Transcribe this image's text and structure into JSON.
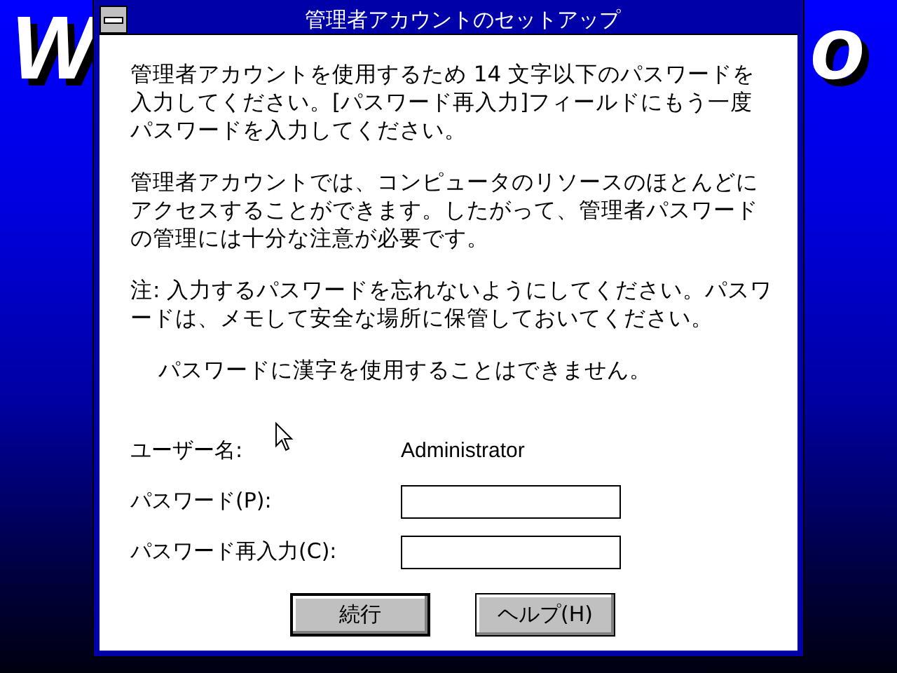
{
  "background": {
    "logo_fragments": [
      "W",
      "o"
    ]
  },
  "window": {
    "title": "管理者アカウントのセットアップ"
  },
  "paragraphs": [
    {
      "text": "管理者アカウントを使用するため 14 文字以下のパスワードを入力してください。[パスワード再入力]フィールドにもう一度パスワードを入力してください。",
      "indented": false
    },
    {
      "text": "管理者アカウントでは、コンピュータのリソースのほとんどにアクセスすることができます。したがって、管理者パスワードの管理には十分な注意が必要です。",
      "indented": false
    },
    {
      "text": "注: 入力するパスワードを忘れないようにしてください。パスワードは、メモして安全な場所に保管しておいてください。",
      "indented": false
    },
    {
      "text": "パスワードに漢字を使用することはできません。",
      "indented": true
    }
  ],
  "form": [
    {
      "kind": "text",
      "label": "ユーザー名:",
      "value": "Administrator"
    },
    {
      "kind": "field",
      "label": "パスワード(P):"
    },
    {
      "kind": "field",
      "label": "パスワード再入力(C):"
    }
  ],
  "buttons": [
    {
      "label": "続行",
      "default": true
    },
    {
      "label": "ヘルプ(H)",
      "default": false
    }
  ]
}
